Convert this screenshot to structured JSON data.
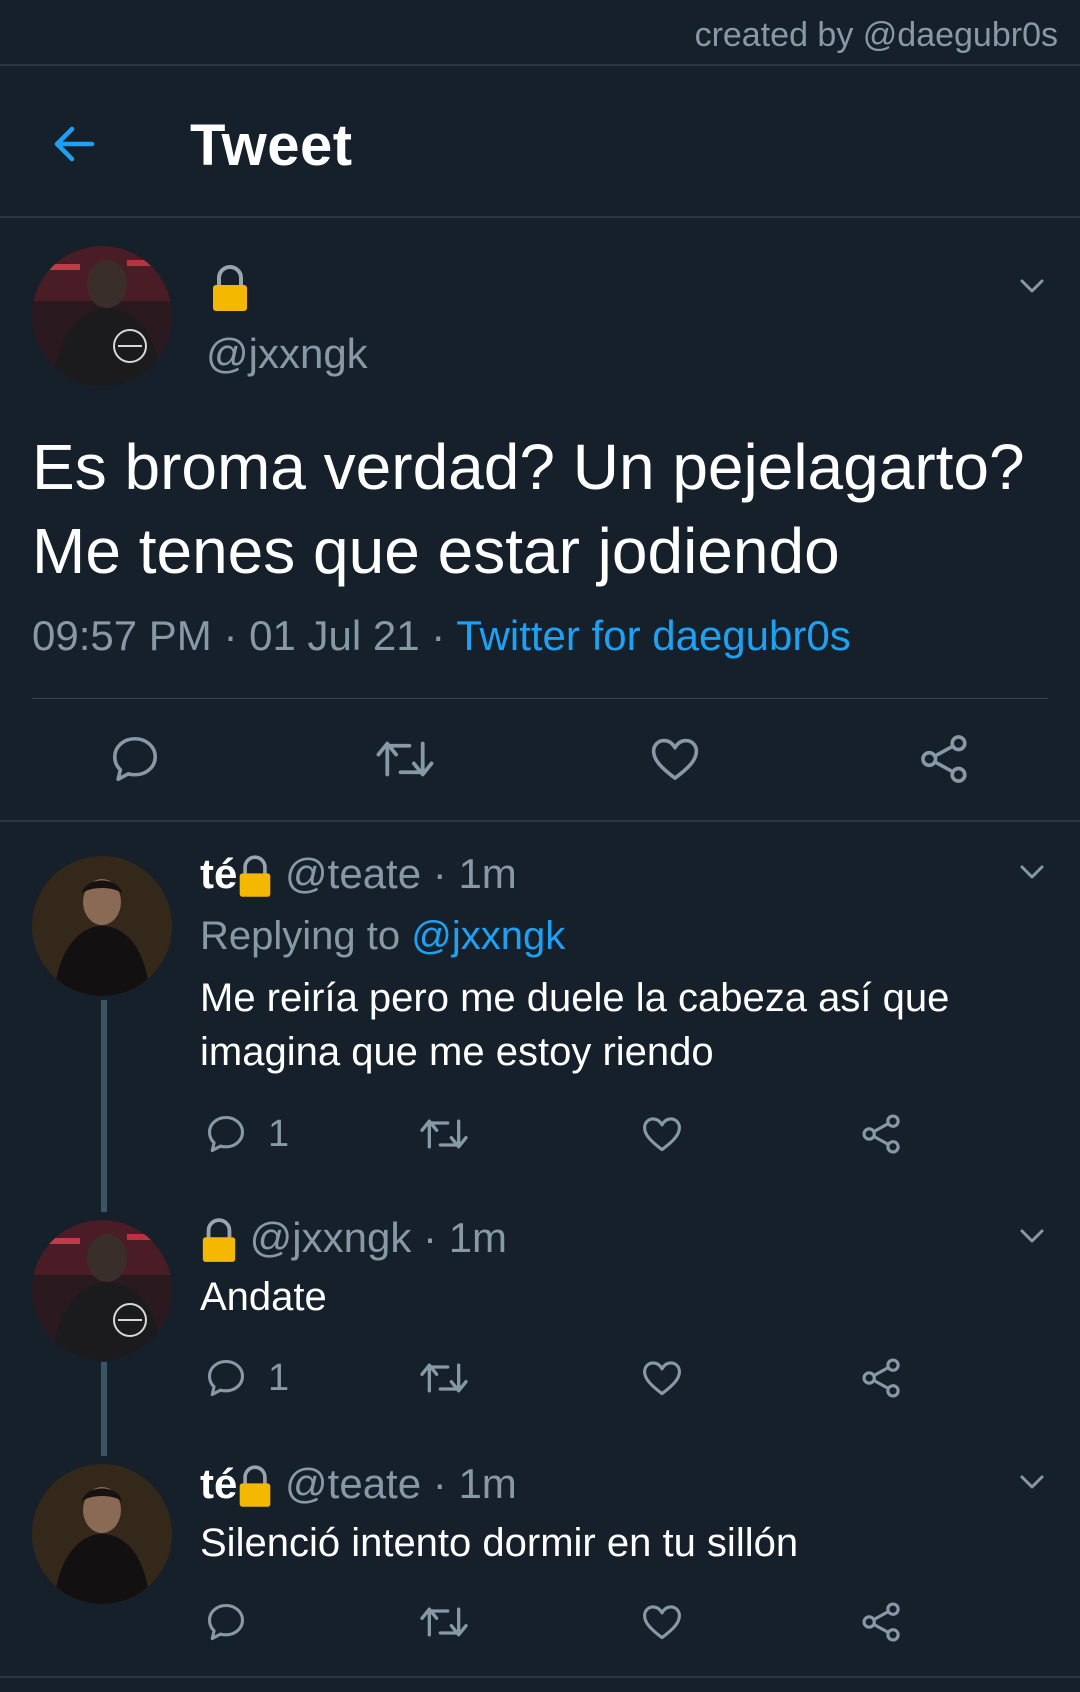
{
  "credit": "created by @daegubr0s",
  "header": {
    "title": "Tweet"
  },
  "main_tweet": {
    "handle": "@jxxngk",
    "text": "Es broma verdad? Un pejelagarto? Me tenes que estar jodiendo",
    "time": "09:57 PM",
    "date": "01 Jul 21",
    "source": "Twitter for daegubr0s",
    "separator": "·"
  },
  "replies": [
    {
      "name": "té",
      "handle": "@teate",
      "ago": "1m",
      "replying_prefix": "Replying to",
      "replying_to": "@jxxngk",
      "text": "Me reiría pero me duele la cabeza así que imagina que me estoy riendo",
      "reply_count": "1"
    },
    {
      "name": "",
      "handle": "@jxxngk",
      "ago": "1m",
      "text": "Andate",
      "reply_count": "1"
    },
    {
      "name": "té",
      "handle": "@teate",
      "ago": "1m",
      "text": "Silenció intento dormir en tu sillón",
      "reply_count": ""
    }
  ],
  "colors": {
    "background": "#15202b",
    "accent": "#1da1f2",
    "muted": "#8899a6",
    "lock": "#f5b800"
  },
  "icons": [
    "back-arrow-icon",
    "lock-icon",
    "chevron-down-icon",
    "reply-icon",
    "retweet-icon",
    "like-icon",
    "share-icon"
  ]
}
